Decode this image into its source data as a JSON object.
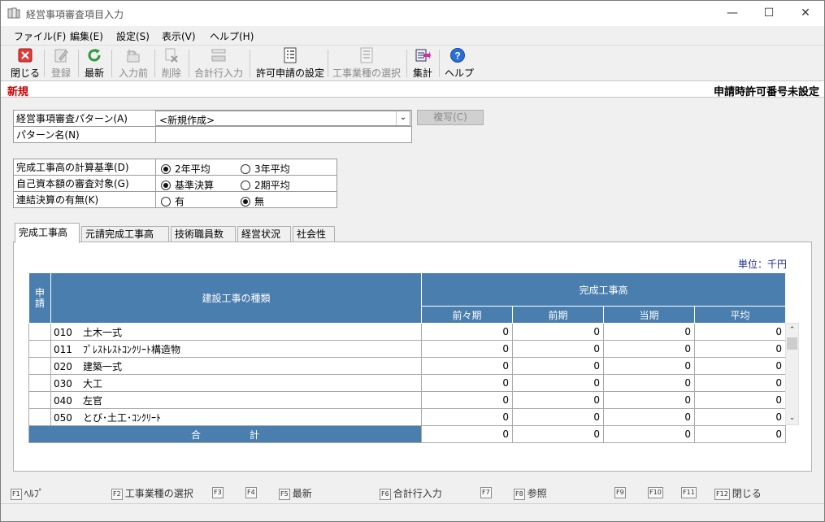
{
  "window": {
    "title": "経営事項審査項目入力",
    "min": "—",
    "max": "☐",
    "close": "✕"
  },
  "menu": [
    "ファイル(F)",
    "編集(E)",
    "設定(S)",
    "表示(V)",
    "ヘルプ(H)"
  ],
  "toolbar": {
    "close": "閉じる",
    "register": "登録",
    "refresh": "最新",
    "prev_input": "入力前",
    "delete": "削除",
    "total_row": "合計行入力",
    "permit_settings": "許可申請の設定",
    "industry_select": "工事業種の選択",
    "aggregate": "集計",
    "help": "ヘルプ"
  },
  "mode": {
    "label": "新規",
    "right": "申請時許可番号未設定"
  },
  "form": {
    "pattern_label": "経営事項審査パターン(A)",
    "pattern_value": "<新規作成>",
    "pattern_name_label": "パターン名(N)",
    "pattern_name_value": "",
    "copy_button": "複写(C)",
    "calc_basis_label": "完成工事高の計算基準(D)",
    "calc_basis_opt1": "2年平均",
    "calc_basis_opt2": "3年平均",
    "capital_label": "自己資本額の審査対象(G)",
    "capital_opt1": "基準決算",
    "capital_opt2": "2期平均",
    "consolidated_label": "連結決算の有無(K)",
    "consolidated_opt1": "有",
    "consolidated_opt2": "無"
  },
  "tabs": [
    "完成工事高",
    "元請完成工事高",
    "技術職員数",
    "経営状況",
    "社会性"
  ],
  "unit": "単位：千円",
  "grid": {
    "col_apply": "申請",
    "col_type": "建設工事の種類",
    "col_group": "完成工事高",
    "col_prev2": "前々期",
    "col_prev": "前期",
    "col_curr": "当期",
    "col_avg": "平均",
    "rows": [
      {
        "code": "010",
        "name": "土木一式",
        "v1": "0",
        "v2": "0",
        "v3": "0",
        "v4": "0"
      },
      {
        "code": "011",
        "name": "ﾌﾟﾚｽﾄﾚｽﾄｺﾝｸﾘｰﾄ構造物",
        "v1": "0",
        "v2": "0",
        "v3": "0",
        "v4": "0"
      },
      {
        "code": "020",
        "name": "建築一式",
        "v1": "0",
        "v2": "0",
        "v3": "0",
        "v4": "0"
      },
      {
        "code": "030",
        "name": "大工",
        "v1": "0",
        "v2": "0",
        "v3": "0",
        "v4": "0"
      },
      {
        "code": "040",
        "name": "左官",
        "v1": "0",
        "v2": "0",
        "v3": "0",
        "v4": "0"
      },
      {
        "code": "050",
        "name": "とび･土工･ｺﾝｸﾘｰﾄ",
        "v1": "0",
        "v2": "0",
        "v3": "0",
        "v4": "0"
      }
    ],
    "total_label": "合　　　　　計",
    "total": {
      "v1": "0",
      "v2": "0",
      "v3": "0",
      "v4": "0"
    }
  },
  "fkeys": {
    "f1": "F1",
    "f1_label": "ﾍﾙﾌﾟ",
    "f2": "F2",
    "f2_label": "工事業種の選択",
    "f3": "F3",
    "f4": "F4",
    "f5": "F5",
    "f5_label": "最新",
    "f6": "F6",
    "f6_label": "合計行入力",
    "f7": "F7",
    "f8": "F8",
    "f8_label": "参照",
    "f9": "F9",
    "f10": "F10",
    "f11": "F11",
    "f12": "F12",
    "f12_label": "閉じる"
  },
  "colors": {
    "header_blue": "#4a7eaf",
    "mode_red": "#d00000",
    "unit_blue": "#1f2e9c"
  }
}
